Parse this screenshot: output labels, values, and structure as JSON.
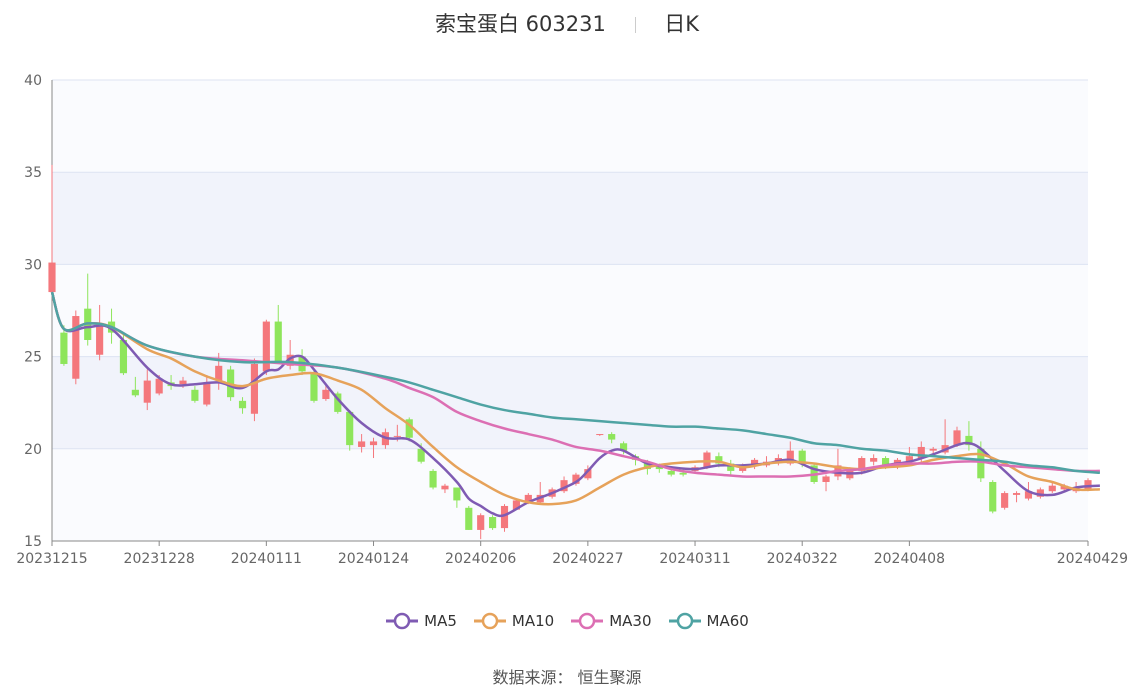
{
  "title": {
    "name": "索宝蛋白 603231",
    "period": "日K"
  },
  "source": "数据来源： 恒生聚源",
  "colors": {
    "up": "#f4777c",
    "down": "#8ee55b",
    "ma5": "#7f5bb3",
    "ma10": "#e6a25a",
    "ma30": "#dc6fb3",
    "ma60": "#4fa3a3"
  },
  "chart_data": {
    "type": "candlestick",
    "ylim": [
      15,
      40
    ],
    "yticks": [
      "40",
      "35",
      "30",
      "25",
      "20",
      "15"
    ],
    "xticks": [
      {
        "label": "20231215",
        "i": 0
      },
      {
        "label": "20231228",
        "i": 9
      },
      {
        "label": "20240111",
        "i": 18
      },
      {
        "label": "20240124",
        "i": 27
      },
      {
        "label": "20240206",
        "i": 36
      },
      {
        "label": "20240227",
        "i": 45
      },
      {
        "label": "20240311",
        "i": 54
      },
      {
        "label": "20240322",
        "i": 63
      },
      {
        "label": "20240408",
        "i": 72
      },
      {
        "label": "20240429",
        "i": 87
      }
    ],
    "candles": [
      [
        28.5,
        30.1,
        35.4,
        28.3
      ],
      [
        26.3,
        24.6,
        26.7,
        24.5
      ],
      [
        23.8,
        27.2,
        27.5,
        23.5
      ],
      [
        27.6,
        25.9,
        29.5,
        25.6
      ],
      [
        25.1,
        26.8,
        27.8,
        24.8
      ],
      [
        26.9,
        26.3,
        27.6,
        25.7
      ],
      [
        25.9,
        24.1,
        26.3,
        24.0
      ],
      [
        23.2,
        22.9,
        23.9,
        22.8
      ],
      [
        22.5,
        23.7,
        24.3,
        22.1
      ],
      [
        23.0,
        23.8,
        24.0,
        22.9
      ],
      [
        23.6,
        23.4,
        24.0,
        23.2
      ],
      [
        23.5,
        23.7,
        23.9,
        23.3
      ],
      [
        23.2,
        22.6,
        23.4,
        22.5
      ],
      [
        22.4,
        23.6,
        24.0,
        22.3
      ],
      [
        23.7,
        24.5,
        25.2,
        23.2
      ],
      [
        24.3,
        22.8,
        24.5,
        22.6
      ],
      [
        22.6,
        22.2,
        22.8,
        21.9
      ],
      [
        21.9,
        24.6,
        24.9,
        21.5
      ],
      [
        24.2,
        26.9,
        27.0,
        24.0
      ],
      [
        26.9,
        24.7,
        27.8,
        24.6
      ],
      [
        24.5,
        25.1,
        25.9,
        24.3
      ],
      [
        25.0,
        24.2,
        25.4,
        24.0
      ],
      [
        24.1,
        22.6,
        24.3,
        22.5
      ],
      [
        22.7,
        23.2,
        23.5,
        22.6
      ],
      [
        23.0,
        22.0,
        23.1,
        21.9
      ],
      [
        22.0,
        20.2,
        22.1,
        19.9
      ],
      [
        20.1,
        20.4,
        20.8,
        19.8
      ],
      [
        20.2,
        20.4,
        20.6,
        19.5
      ],
      [
        20.2,
        20.9,
        21.1,
        20.0
      ],
      [
        20.7,
        20.7,
        21.3,
        20.4
      ],
      [
        21.6,
        20.6,
        21.7,
        20.4
      ],
      [
        20.0,
        19.3,
        20.3,
        19.2
      ],
      [
        18.8,
        17.9,
        18.9,
        17.8
      ],
      [
        17.8,
        18.0,
        18.1,
        17.6
      ],
      [
        17.9,
        17.2,
        17.9,
        16.8
      ],
      [
        16.8,
        15.6,
        16.9,
        15.6
      ],
      [
        15.6,
        16.4,
        16.5,
        15.1
      ],
      [
        16.3,
        15.7,
        16.4,
        15.6
      ],
      [
        15.7,
        16.9,
        17.0,
        15.5
      ],
      [
        16.7,
        17.2,
        17.3,
        16.7
      ],
      [
        17.1,
        17.5,
        17.6,
        17.0
      ],
      [
        17.1,
        17.5,
        18.2,
        17.0
      ],
      [
        17.4,
        17.8,
        17.9,
        17.3
      ],
      [
        17.7,
        18.3,
        18.5,
        17.6
      ],
      [
        18.1,
        18.6,
        18.7,
        18.0
      ],
      [
        18.4,
        18.9,
        19.1,
        18.3
      ],
      [
        20.8,
        20.8,
        20.8,
        20.7
      ],
      [
        20.8,
        20.5,
        20.9,
        20.3
      ],
      [
        20.3,
        19.9,
        20.4,
        19.7
      ],
      [
        19.6,
        19.4,
        19.7,
        19.1
      ],
      [
        19.2,
        18.9,
        19.4,
        18.6
      ],
      [
        19.1,
        18.9,
        19.2,
        18.7
      ],
      [
        18.8,
        18.6,
        19.0,
        18.5
      ],
      [
        18.7,
        18.6,
        18.9,
        18.5
      ],
      [
        18.8,
        19.0,
        19.1,
        18.7
      ],
      [
        19.0,
        19.8,
        19.9,
        18.9
      ],
      [
        19.6,
        19.2,
        19.8,
        19.0
      ],
      [
        19.2,
        18.8,
        19.4,
        18.6
      ],
      [
        18.8,
        19.1,
        19.2,
        18.7
      ],
      [
        19.1,
        19.4,
        19.5,
        18.9
      ],
      [
        19.1,
        19.3,
        19.6,
        19.0
      ],
      [
        19.3,
        19.5,
        19.7,
        19.1
      ],
      [
        19.2,
        19.9,
        20.4,
        19.1
      ],
      [
        19.9,
        19.2,
        20.0,
        19.0
      ],
      [
        19.1,
        18.2,
        19.2,
        18.1
      ],
      [
        18.2,
        18.5,
        18.6,
        17.7
      ],
      [
        18.5,
        19.1,
        20.0,
        18.3
      ],
      [
        18.4,
        18.9,
        19.0,
        18.3
      ],
      [
        18.8,
        19.5,
        19.6,
        18.6
      ],
      [
        19.3,
        19.5,
        19.7,
        19.1
      ],
      [
        19.5,
        19.1,
        19.6,
        18.9
      ],
      [
        19.0,
        19.4,
        19.5,
        18.9
      ],
      [
        19.3,
        19.6,
        20.1,
        19.2
      ],
      [
        19.5,
        20.1,
        20.4,
        19.3
      ],
      [
        19.9,
        20.0,
        20.1,
        19.6
      ],
      [
        19.8,
        20.2,
        21.6,
        19.7
      ],
      [
        20.2,
        21.0,
        21.2,
        20.1
      ],
      [
        20.7,
        20.2,
        21.5,
        19.9
      ],
      [
        20.0,
        18.4,
        20.4,
        18.2
      ],
      [
        18.2,
        16.6,
        18.3,
        16.5
      ],
      [
        16.8,
        17.6,
        17.7,
        16.7
      ],
      [
        17.5,
        17.6,
        17.7,
        17.1
      ],
      [
        17.3,
        17.7,
        18.2,
        17.2
      ],
      [
        17.4,
        17.8,
        17.9,
        17.3
      ],
      [
        17.7,
        18.0,
        18.2,
        17.6
      ],
      [
        17.8,
        18.0,
        18.1,
        17.7
      ],
      [
        17.7,
        17.9,
        18.2,
        17.6
      ],
      [
        17.8,
        18.3,
        18.4,
        17.7
      ]
    ],
    "series": [
      {
        "name": "MA5",
        "color": "#7f5bb3",
        "points": [
          [
            0,
            28.5
          ],
          [
            1,
            26.5
          ],
          [
            3,
            26.6
          ],
          [
            5,
            26.5
          ],
          [
            8,
            24.4
          ],
          [
            10,
            23.5
          ],
          [
            12,
            23.5
          ],
          [
            14,
            23.6
          ],
          [
            16,
            23.3
          ],
          [
            18,
            24.2
          ],
          [
            19,
            24.3
          ],
          [
            20,
            24.9
          ],
          [
            21,
            25.0
          ],
          [
            22,
            24.3
          ],
          [
            24,
            22.7
          ],
          [
            26,
            21.4
          ],
          [
            28,
            20.6
          ],
          [
            30,
            20.5
          ],
          [
            32,
            19.5
          ],
          [
            34,
            18.2
          ],
          [
            35,
            17.3
          ],
          [
            36,
            16.9
          ],
          [
            37,
            16.5
          ],
          [
            38,
            16.4
          ],
          [
            40,
            17.1
          ],
          [
            42,
            17.6
          ],
          [
            44,
            18.2
          ],
          [
            45,
            18.8
          ],
          [
            46,
            19.5
          ],
          [
            47,
            19.9
          ],
          [
            48,
            19.9
          ],
          [
            50,
            19.2
          ],
          [
            52,
            19.0
          ],
          [
            54,
            18.9
          ],
          [
            56,
            19.1
          ],
          [
            58,
            19.1
          ],
          [
            60,
            19.2
          ],
          [
            62,
            19.4
          ],
          [
            64,
            18.9
          ],
          [
            66,
            18.7
          ],
          [
            68,
            18.7
          ],
          [
            70,
            19.1
          ],
          [
            72,
            19.3
          ],
          [
            74,
            19.7
          ],
          [
            76,
            20.2
          ],
          [
            77,
            20.3
          ],
          [
            78,
            20.0
          ],
          [
            80,
            18.8
          ],
          [
            82,
            17.7
          ],
          [
            84,
            17.5
          ],
          [
            86,
            17.9
          ],
          [
            88,
            18.0
          ]
        ]
      },
      {
        "name": "MA10",
        "color": "#e6a25a",
        "points": [
          [
            0,
            28.5
          ],
          [
            1,
            26.5
          ],
          [
            3,
            26.8
          ],
          [
            5,
            26.6
          ],
          [
            8,
            25.4
          ],
          [
            10,
            24.9
          ],
          [
            12,
            24.2
          ],
          [
            14,
            23.7
          ],
          [
            16,
            23.4
          ],
          [
            18,
            23.8
          ],
          [
            20,
            24.0
          ],
          [
            22,
            24.1
          ],
          [
            24,
            23.7
          ],
          [
            26,
            23.2
          ],
          [
            28,
            22.2
          ],
          [
            30,
            21.3
          ],
          [
            32,
            20.1
          ],
          [
            34,
            19.0
          ],
          [
            36,
            18.2
          ],
          [
            38,
            17.5
          ],
          [
            40,
            17.1
          ],
          [
            42,
            17.0
          ],
          [
            44,
            17.2
          ],
          [
            46,
            17.9
          ],
          [
            48,
            18.6
          ],
          [
            50,
            19.0
          ],
          [
            52,
            19.2
          ],
          [
            54,
            19.3
          ],
          [
            56,
            19.3
          ],
          [
            58,
            19.0
          ],
          [
            60,
            19.2
          ],
          [
            62,
            19.3
          ],
          [
            64,
            19.2
          ],
          [
            66,
            19.0
          ],
          [
            68,
            18.9
          ],
          [
            70,
            19.0
          ],
          [
            72,
            19.1
          ],
          [
            74,
            19.4
          ],
          [
            76,
            19.6
          ],
          [
            78,
            19.7
          ],
          [
            80,
            19.2
          ],
          [
            82,
            18.5
          ],
          [
            84,
            18.2
          ],
          [
            86,
            17.8
          ],
          [
            88,
            17.8
          ]
        ]
      },
      {
        "name": "MA30",
        "color": "#dc6fb3",
        "points": [
          [
            0,
            28.5
          ],
          [
            1,
            26.5
          ],
          [
            3,
            26.8
          ],
          [
            5,
            26.6
          ],
          [
            8,
            25.6
          ],
          [
            12,
            25.0
          ],
          [
            16,
            24.8
          ],
          [
            20,
            24.6
          ],
          [
            24,
            24.4
          ],
          [
            28,
            23.8
          ],
          [
            30,
            23.3
          ],
          [
            32,
            22.8
          ],
          [
            34,
            22.0
          ],
          [
            36,
            21.5
          ],
          [
            38,
            21.1
          ],
          [
            40,
            20.8
          ],
          [
            42,
            20.5
          ],
          [
            44,
            20.1
          ],
          [
            46,
            19.9
          ],
          [
            48,
            19.6
          ],
          [
            50,
            19.3
          ],
          [
            52,
            18.9
          ],
          [
            54,
            18.7
          ],
          [
            56,
            18.6
          ],
          [
            58,
            18.5
          ],
          [
            60,
            18.5
          ],
          [
            62,
            18.5
          ],
          [
            64,
            18.6
          ],
          [
            66,
            18.8
          ],
          [
            68,
            18.9
          ],
          [
            70,
            19.1
          ],
          [
            72,
            19.2
          ],
          [
            74,
            19.2
          ],
          [
            76,
            19.3
          ],
          [
            78,
            19.3
          ],
          [
            80,
            19.1
          ],
          [
            82,
            19.0
          ],
          [
            84,
            18.9
          ],
          [
            86,
            18.8
          ],
          [
            88,
            18.8
          ]
        ]
      },
      {
        "name": "MA60",
        "color": "#4fa3a3",
        "points": [
          [
            0,
            28.5
          ],
          [
            1,
            26.5
          ],
          [
            3,
            26.8
          ],
          [
            5,
            26.6
          ],
          [
            8,
            25.6
          ],
          [
            12,
            25.0
          ],
          [
            16,
            24.7
          ],
          [
            20,
            24.7
          ],
          [
            24,
            24.4
          ],
          [
            28,
            23.9
          ],
          [
            30,
            23.6
          ],
          [
            32,
            23.2
          ],
          [
            34,
            22.8
          ],
          [
            36,
            22.4
          ],
          [
            38,
            22.1
          ],
          [
            40,
            21.9
          ],
          [
            42,
            21.7
          ],
          [
            44,
            21.6
          ],
          [
            46,
            21.5
          ],
          [
            48,
            21.4
          ],
          [
            50,
            21.3
          ],
          [
            52,
            21.2
          ],
          [
            54,
            21.2
          ],
          [
            56,
            21.1
          ],
          [
            58,
            21.0
          ],
          [
            60,
            20.8
          ],
          [
            62,
            20.6
          ],
          [
            64,
            20.3
          ],
          [
            66,
            20.2
          ],
          [
            68,
            20.0
          ],
          [
            70,
            19.9
          ],
          [
            72,
            19.7
          ],
          [
            74,
            19.6
          ],
          [
            76,
            19.5
          ],
          [
            78,
            19.4
          ],
          [
            80,
            19.3
          ],
          [
            82,
            19.1
          ],
          [
            84,
            19.0
          ],
          [
            86,
            18.8
          ],
          [
            88,
            18.7
          ]
        ]
      }
    ],
    "legend": [
      "MA5",
      "MA10",
      "MA30",
      "MA60"
    ],
    "legend_position": "bottom"
  }
}
